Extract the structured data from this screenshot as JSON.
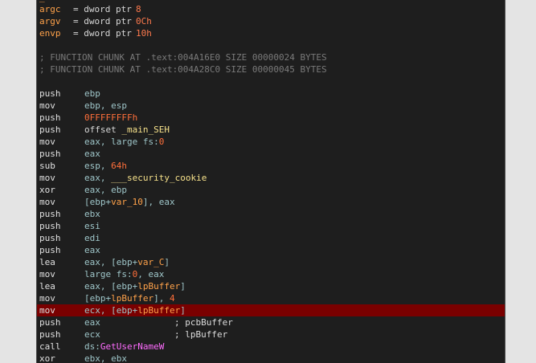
{
  "colors": {
    "background": "#1e1e1e",
    "highlight_row": "#7a0000",
    "mnemonic": "#e0e0e0",
    "register": "#9fc6c9",
    "number": "#ff6f3a",
    "name": "#f5e08a",
    "variable": "#ffa24a",
    "api_import": "#ff6cff",
    "comment": "#7a7a7a"
  },
  "header": {
    "partial_line": "_",
    "args": [
      {
        "name": "argc",
        "def": "= dword ptr",
        "offset": "8"
      },
      {
        "name": "argv",
        "def": "= dword ptr",
        "offset": "0Ch"
      },
      {
        "name": "envp",
        "def": "= dword ptr",
        "offset": "10h"
      }
    ],
    "chunks": [
      "; FUNCTION CHUNK AT .text:004A16E0 SIZE 00000024 BYTES",
      "; FUNCTION CHUNK AT .text:004A28C0 SIZE 00000045 BYTES"
    ]
  },
  "instructions": [
    {
      "mnemonic": "push",
      "tokens": [
        {
          "t": "ebp",
          "k": "reg"
        }
      ],
      "comment": "",
      "highlighted": false
    },
    {
      "mnemonic": "mov",
      "tokens": [
        {
          "t": "ebp, esp",
          "k": "reg"
        }
      ],
      "comment": "",
      "highlighted": false
    },
    {
      "mnemonic": "push",
      "tokens": [
        {
          "t": "0FFFFFFFFh",
          "k": "num"
        }
      ],
      "comment": "",
      "highlighted": false
    },
    {
      "mnemonic": "push",
      "tokens": [
        {
          "t": "offset ",
          "k": "plain"
        },
        {
          "t": "_main_SEH",
          "k": "name"
        }
      ],
      "comment": "",
      "highlighted": false
    },
    {
      "mnemonic": "mov",
      "tokens": [
        {
          "t": "eax, large fs:",
          "k": "reg"
        },
        {
          "t": "0",
          "k": "num"
        }
      ],
      "comment": "",
      "highlighted": false
    },
    {
      "mnemonic": "push",
      "tokens": [
        {
          "t": "eax",
          "k": "reg"
        }
      ],
      "comment": "",
      "highlighted": false
    },
    {
      "mnemonic": "sub",
      "tokens": [
        {
          "t": "esp, ",
          "k": "reg"
        },
        {
          "t": "64h",
          "k": "num"
        }
      ],
      "comment": "",
      "highlighted": false
    },
    {
      "mnemonic": "mov",
      "tokens": [
        {
          "t": "eax, ",
          "k": "reg"
        },
        {
          "t": "___security_cookie",
          "k": "name"
        }
      ],
      "comment": "",
      "highlighted": false
    },
    {
      "mnemonic": "xor",
      "tokens": [
        {
          "t": "eax, ebp",
          "k": "reg"
        }
      ],
      "comment": "",
      "highlighted": false
    },
    {
      "mnemonic": "mov",
      "tokens": [
        {
          "t": "[ebp+",
          "k": "reg"
        },
        {
          "t": "var_10",
          "k": "var"
        },
        {
          "t": "], eax",
          "k": "reg"
        }
      ],
      "comment": "",
      "highlighted": false
    },
    {
      "mnemonic": "push",
      "tokens": [
        {
          "t": "ebx",
          "k": "reg"
        }
      ],
      "comment": "",
      "highlighted": false
    },
    {
      "mnemonic": "push",
      "tokens": [
        {
          "t": "esi",
          "k": "reg"
        }
      ],
      "comment": "",
      "highlighted": false
    },
    {
      "mnemonic": "push",
      "tokens": [
        {
          "t": "edi",
          "k": "reg"
        }
      ],
      "comment": "",
      "highlighted": false
    },
    {
      "mnemonic": "push",
      "tokens": [
        {
          "t": "eax",
          "k": "reg"
        }
      ],
      "comment": "",
      "highlighted": false
    },
    {
      "mnemonic": "lea",
      "tokens": [
        {
          "t": "eax, [ebp+",
          "k": "reg"
        },
        {
          "t": "var_C",
          "k": "var"
        },
        {
          "t": "]",
          "k": "reg"
        }
      ],
      "comment": "",
      "highlighted": false
    },
    {
      "mnemonic": "mov",
      "tokens": [
        {
          "t": "large fs:",
          "k": "reg"
        },
        {
          "t": "0",
          "k": "num"
        },
        {
          "t": ", eax",
          "k": "reg"
        }
      ],
      "comment": "",
      "highlighted": false
    },
    {
      "mnemonic": "lea",
      "tokens": [
        {
          "t": "eax, [ebp+",
          "k": "reg"
        },
        {
          "t": "lpBuffer",
          "k": "var"
        },
        {
          "t": "]",
          "k": "reg"
        }
      ],
      "comment": "",
      "highlighted": false
    },
    {
      "mnemonic": "mov",
      "tokens": [
        {
          "t": "[ebp+",
          "k": "reg"
        },
        {
          "t": "lpBuffer",
          "k": "var"
        },
        {
          "t": "], ",
          "k": "reg"
        },
        {
          "t": "4",
          "k": "num"
        }
      ],
      "comment": "",
      "highlighted": false
    },
    {
      "mnemonic": "mov",
      "tokens": [
        {
          "t": "ecx, [ebp+",
          "k": "reg"
        },
        {
          "t": "lpBuffer",
          "k": "var"
        },
        {
          "t": "]",
          "k": "reg"
        }
      ],
      "comment": "",
      "highlighted": true
    },
    {
      "mnemonic": "push",
      "tokens": [
        {
          "t": "eax",
          "k": "reg"
        }
      ],
      "comment": "; pcbBuffer",
      "highlighted": false
    },
    {
      "mnemonic": "push",
      "tokens": [
        {
          "t": "ecx",
          "k": "reg"
        }
      ],
      "comment": "; lpBuffer",
      "highlighted": false
    },
    {
      "mnemonic": "call",
      "tokens": [
        {
          "t": "ds:",
          "k": "reg"
        },
        {
          "t": "GetUserNameW",
          "k": "api"
        }
      ],
      "comment": "",
      "highlighted": false
    },
    {
      "mnemonic": "xor",
      "tokens": [
        {
          "t": "ebx, ebx",
          "k": "reg"
        }
      ],
      "comment": "",
      "highlighted": false
    }
  ]
}
